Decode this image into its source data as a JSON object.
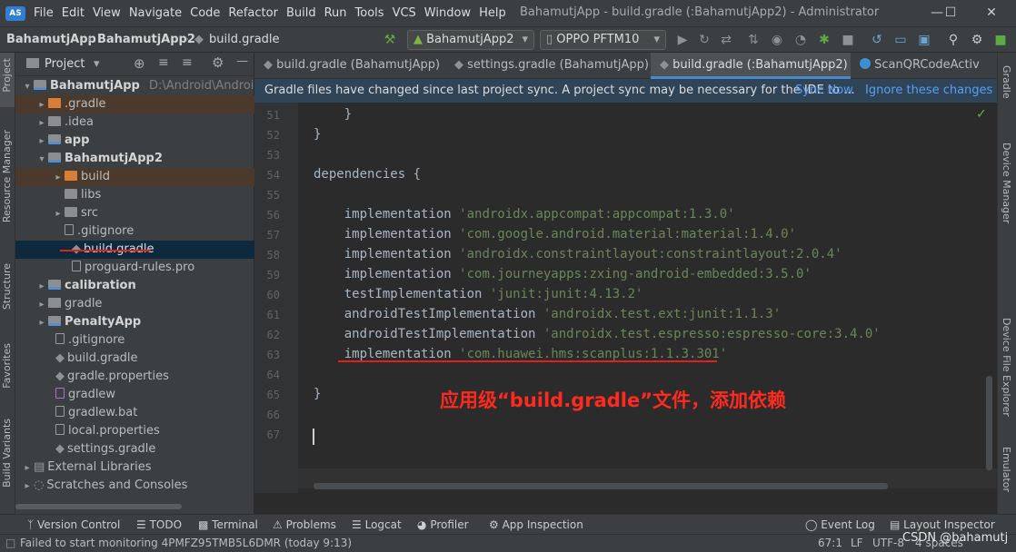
{
  "menu": {
    "items": [
      "File",
      "Edit",
      "View",
      "Navigate",
      "Code",
      "Refactor",
      "Build",
      "Run",
      "Tools",
      "VCS",
      "Window",
      "Help"
    ],
    "title": "BahamutjApp - build.gradle (:BahamutjApp2) - Administrator"
  },
  "toolbar": {
    "crumbs": [
      "BahamutjApp",
      "BahamutjApp2",
      "build.gradle"
    ],
    "run_config": "BahamutjApp2",
    "device": "OPPO PFTM10"
  },
  "left_strip": [
    "Project",
    "Resource Manager",
    "Structure",
    "Favorites",
    "Build Variants"
  ],
  "right_strip": [
    "Gradle",
    "Device Manager",
    "Device File Explorer",
    "Emulator"
  ],
  "project": {
    "header": "Project",
    "root_path": "D:\\Android\\AndroidPr",
    "rows": [
      "BahamutjApp",
      ".gradle",
      ".idea",
      "app",
      "BahamutjApp2",
      "build",
      "libs",
      "src",
      ".gitignore",
      "build.gradle",
      "proguard-rules.pro",
      "calibration",
      "gradle",
      "PenaltyApp",
      ".gitignore",
      "build.gradle",
      "gradle.properties",
      "gradlew",
      "gradlew.bat",
      "local.properties",
      "settings.gradle",
      "External Libraries",
      "Scratches and Consoles"
    ]
  },
  "tabs": [
    "build.gradle (BahamutjApp)",
    "settings.gradle (BahamutjApp)",
    "build.gradle (:BahamutjApp2)",
    "ScanQRCodeActiv"
  ],
  "banner": {
    "message": "Gradle files have changed since last project sync. A project sync may be necessary for the IDE to ...",
    "sync_now": "Sync Now",
    "ignore": "Ignore these changes"
  },
  "editor": {
    "line_numbers": [
      "51",
      "52",
      "53",
      "54",
      "55",
      "56",
      "57",
      "58",
      "59",
      "60",
      "61",
      "62",
      "63",
      "64",
      "65",
      "66",
      "67"
    ],
    "lines": [
      {
        "kw": "    }",
        "str": ""
      },
      {
        "kw": "}",
        "str": ""
      },
      {
        "kw": "",
        "str": ""
      },
      {
        "kw": "dependencies {",
        "str": ""
      },
      {
        "kw": "",
        "str": ""
      },
      {
        "kw": "    implementation ",
        "str": "'androidx.appcompat:appcompat:1.3.0'"
      },
      {
        "kw": "    implementation ",
        "str": "'com.google.android.material:material:1.4.0'"
      },
      {
        "kw": "    implementation ",
        "str": "'androidx.constraintlayout:constraintlayout:2.0.4'"
      },
      {
        "kw": "    implementation ",
        "str": "'com.journeyapps:zxing-android-embedded:3.5.0'"
      },
      {
        "kw": "    testImplementation ",
        "str": "'junit:junit:4.13.2'"
      },
      {
        "kw": "    androidTestImplementation ",
        "str": "'androidx.test.ext:junit:1.1.3'"
      },
      {
        "kw": "    androidTestImplementation ",
        "str": "'androidx.test.espresso:espresso-core:3.4.0'"
      },
      {
        "kw": "    implementation ",
        "str": "'com.huawei.hms:scanplus:1.1.3.301'"
      },
      {
        "kw": "",
        "str": ""
      },
      {
        "kw": "}",
        "str": ""
      },
      {
        "kw": "",
        "str": ""
      },
      {
        "kw": "",
        "str": ""
      }
    ],
    "annotation": "应用级“build.gradle”文件，添加依赖"
  },
  "bottom_tabs": [
    "Version Control",
    "TODO",
    "Terminal",
    "Problems",
    "Logcat",
    "Profiler",
    "App Inspection",
    "Event Log",
    "Layout Inspector"
  ],
  "status": {
    "message": "Failed to start monitoring 4PMFZ95TMB5L6DMR (today 9:13)",
    "position": "67:1",
    "line_sep": "LF",
    "encoding": "UTF-8",
    "indent": "4 spaces",
    "watermark": "CSDN @bahamutj"
  }
}
